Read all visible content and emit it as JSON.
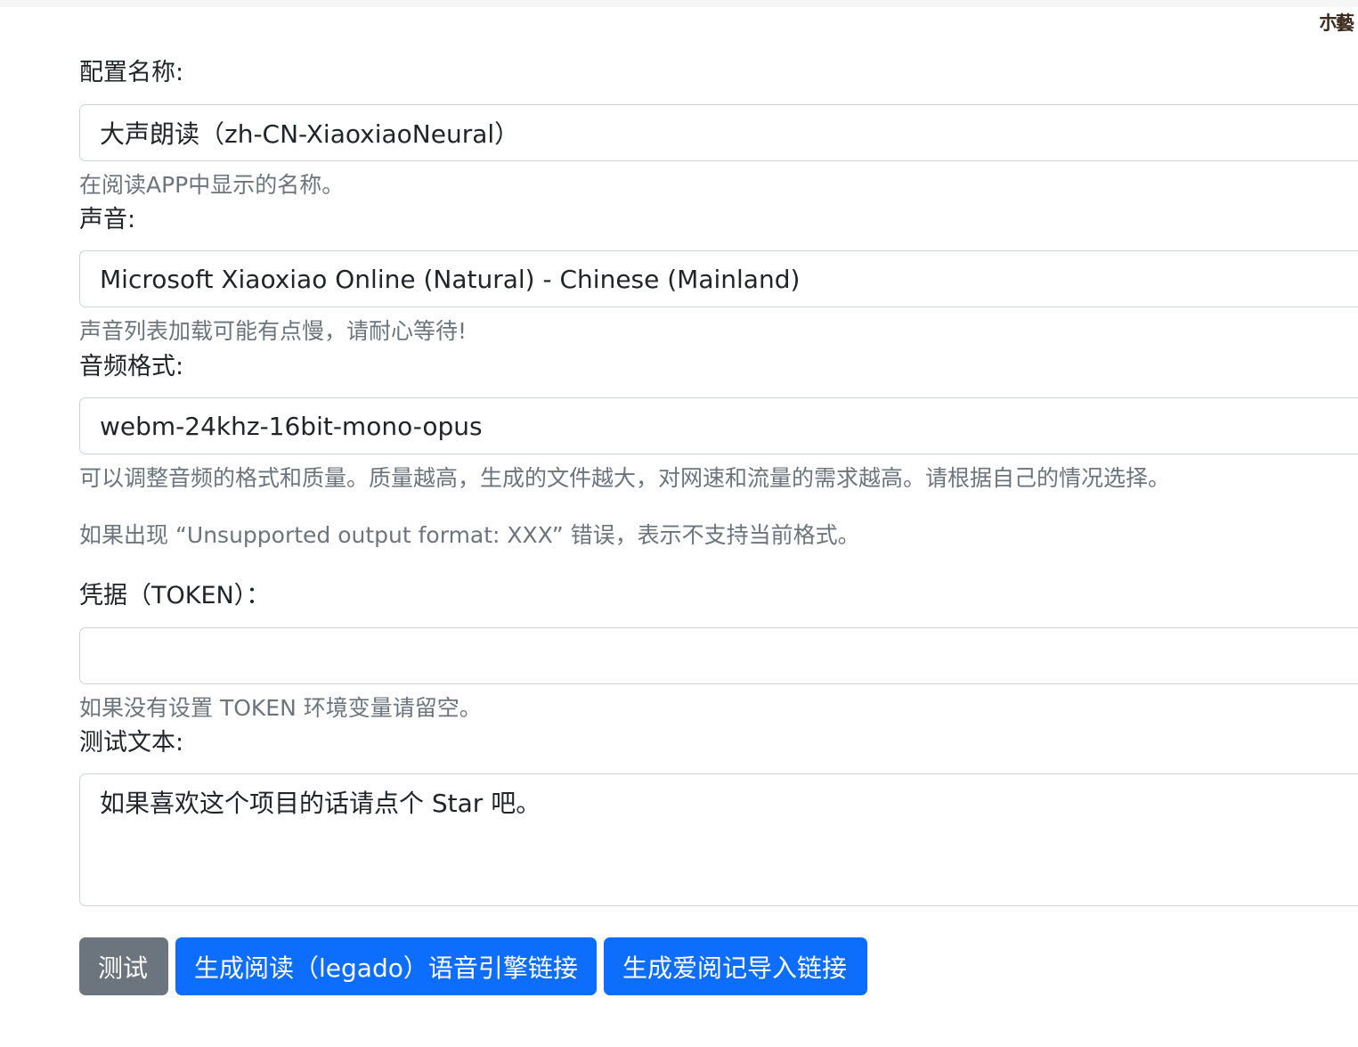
{
  "form": {
    "config_name": {
      "label": "配置名称:",
      "value": "大声朗读（zh-CN-XiaoxiaoNeural）",
      "help": "在阅读APP中显示的名称。"
    },
    "voice": {
      "label": "声音:",
      "selected": "Microsoft Xiaoxiao Online (Natural) - Chinese (Mainland)",
      "help": "声音列表加载可能有点慢，请耐心等待!"
    },
    "audio_format": {
      "label": "音频格式:",
      "selected": "webm-24khz-16bit-mono-opus",
      "help_1": "可以调整音频的格式和质量。质量越高，生成的文件越大，对网速和流量的需求越高。请根据自己的情况选择。",
      "help_2": "如果出现 “Unsupported output format: XXX” 错误，表示不支持当前格式。"
    },
    "token": {
      "label": "凭据（TOKEN）：",
      "value": "",
      "help": "如果没有设置 TOKEN 环境变量请留空。"
    },
    "test_text": {
      "label": "测试文本:",
      "value": "如果喜欢这个项目的话请点个 Star 吧。"
    }
  },
  "buttons": {
    "test": "测试",
    "legado": "生成阅读（legado）语音引擎链接",
    "ireader": "生成爱阅记导入链接"
  },
  "colors": {
    "primary": "#0d6efd",
    "secondary": "#6c757d",
    "muted_text": "#6c757d",
    "border": "#ced4da"
  }
}
